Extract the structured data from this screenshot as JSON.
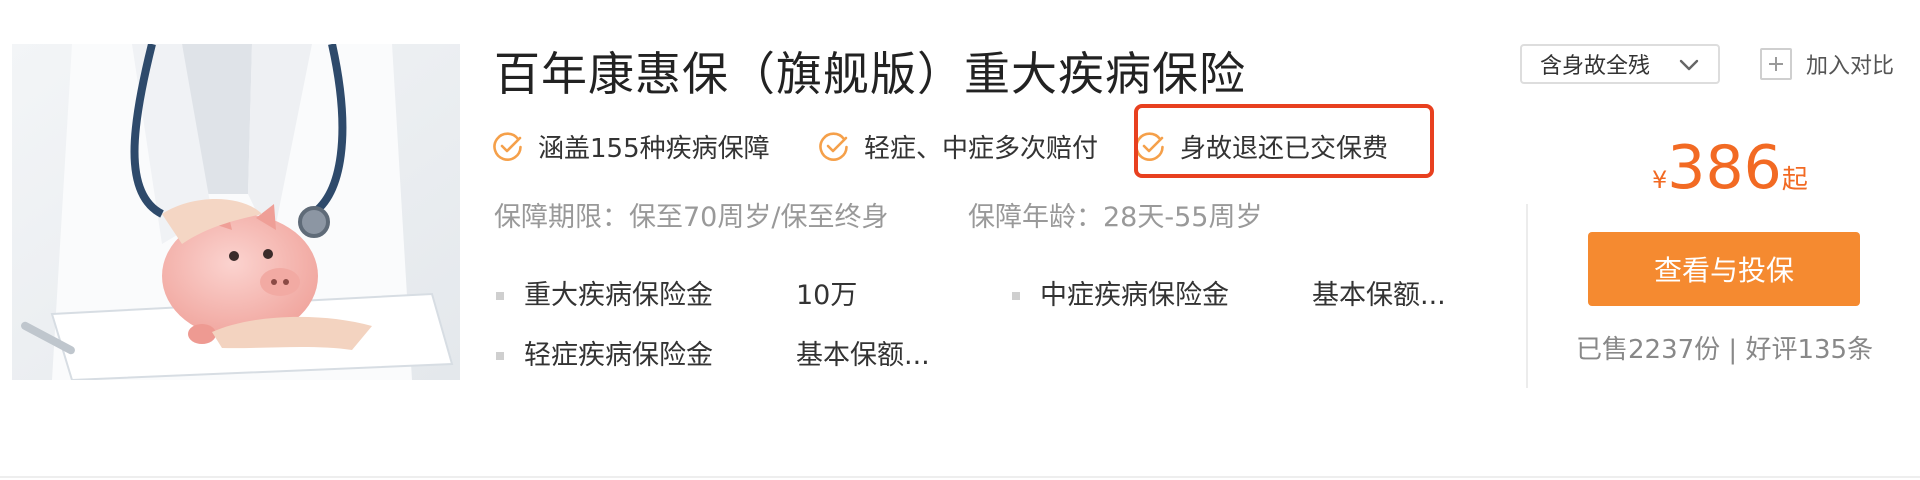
{
  "product": {
    "title": "百年康惠保（旗舰版）重大疾病保险",
    "features": [
      "涵盖155种疾病保障",
      "轻症、中症多次赔付",
      "身故退还已交保费"
    ],
    "highlighted_feature_index": 2,
    "terms": {
      "period": "保障期限：保至70周岁/保至终身",
      "age": "保障年龄：28天-55周岁"
    },
    "coverage": [
      {
        "name": "重大疾病保险金",
        "value": "10万"
      },
      {
        "name": "中症疾病保险金",
        "value": "基本保额..."
      },
      {
        "name": "轻症疾病保险金",
        "value": "基本保额..."
      }
    ],
    "image_icon": "piggy-bank-doctor-photo"
  },
  "controls": {
    "plan_select": "含身故全残",
    "compare_label": "加入对比"
  },
  "pricing": {
    "currency": "¥",
    "amount": "386",
    "suffix": "起"
  },
  "cta": {
    "label": "查看与投保"
  },
  "stats": {
    "sold_reviews": "已售2237份 | 好评135条"
  },
  "colors": {
    "accent": "#f58a30",
    "price": "#f26a23",
    "highlight_border": "#e8401f",
    "check": "#f5a04a"
  }
}
